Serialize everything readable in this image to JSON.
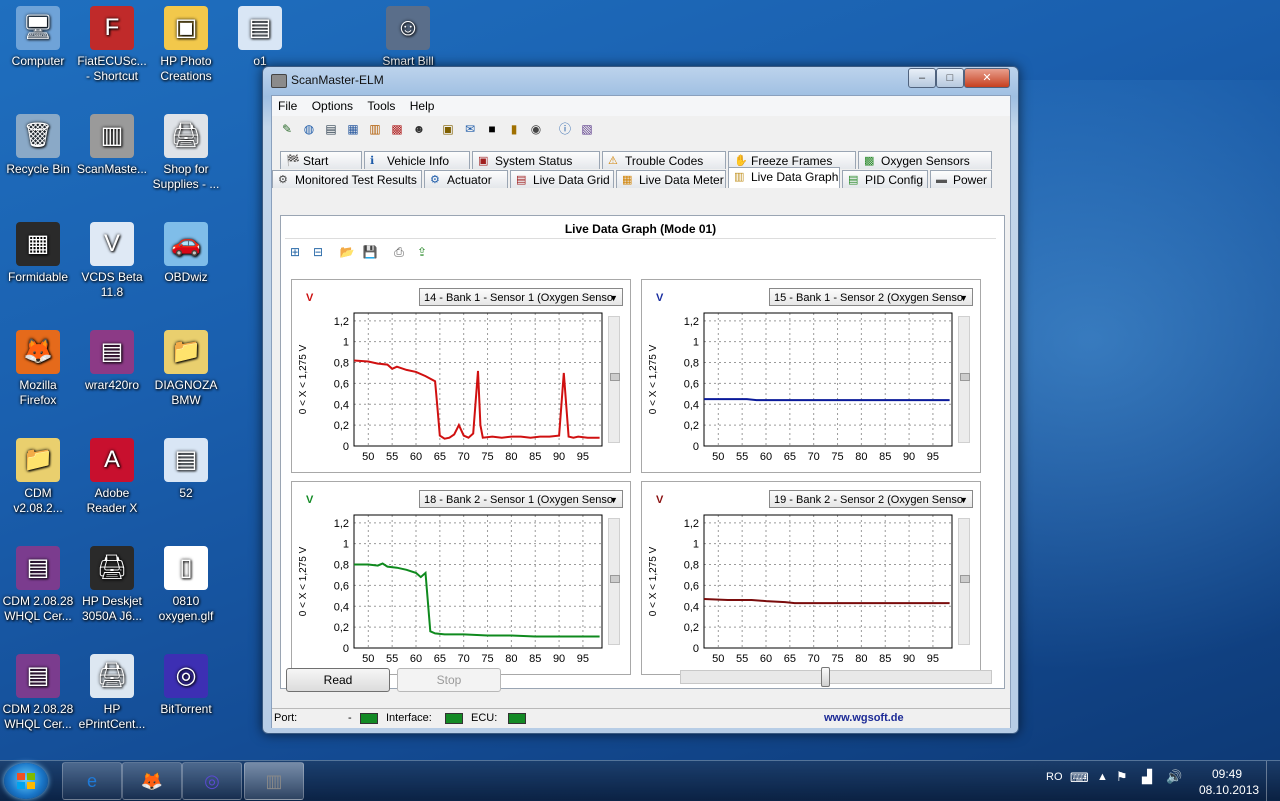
{
  "desktop": {
    "icons": [
      {
        "label": "Computer",
        "col": 0,
        "row": 0,
        "glyph": "🖥",
        "bg": "#6fa3d8"
      },
      {
        "label": "Recycle Bin",
        "col": 0,
        "row": 1,
        "glyph": "🗑",
        "bg": "#8aa9c7"
      },
      {
        "label": "Formidable",
        "col": 0,
        "row": 2,
        "glyph": "▦",
        "bg": "#2a2a2a",
        "sc": true
      },
      {
        "label": "Mozilla Firefox",
        "col": 0,
        "row": 3,
        "glyph": "🦊",
        "bg": "#e56a1b"
      },
      {
        "label": "CDM v2.08.2...",
        "col": 0,
        "row": 4,
        "glyph": "📁",
        "bg": "#e9cf6e"
      },
      {
        "label": "CDM 2.08.28 WHQL Cer...",
        "col": 0,
        "row": 5,
        "glyph": "▤",
        "bg": "#7b3c8e"
      },
      {
        "label": "CDM 2.08.28 WHQL Cer...",
        "col": 0,
        "row": 6,
        "glyph": "▤",
        "bg": "#7b3c8e"
      },
      {
        "label": "FiatECUSc... - Shortcut",
        "col": 1,
        "row": 0,
        "glyph": "F",
        "bg": "#c02a2a",
        "sc": true
      },
      {
        "label": "ScanMaste...",
        "col": 1,
        "row": 1,
        "glyph": "▥",
        "bg": "#9a9a9a"
      },
      {
        "label": "VCDS Beta 11.8",
        "col": 1,
        "row": 2,
        "glyph": "V",
        "bg": "#dfe9f5",
        "sc": true
      },
      {
        "label": "wrar420ro",
        "col": 1,
        "row": 3,
        "glyph": "▤",
        "bg": "#8c3a86"
      },
      {
        "label": "Adobe Reader X",
        "col": 1,
        "row": 4,
        "glyph": "A",
        "bg": "#c8102e"
      },
      {
        "label": "HP Deskjet 3050A J6...",
        "col": 1,
        "row": 5,
        "glyph": "🖨",
        "bg": "#2a2a2a",
        "sc": true
      },
      {
        "label": "HP ePrintCent...",
        "col": 1,
        "row": 6,
        "glyph": "🖨",
        "bg": "#dde7f1",
        "sc": true
      },
      {
        "label": "HP Photo Creations",
        "col": 2,
        "row": 0,
        "glyph": "▣",
        "bg": "#f2c84b",
        "sc": true
      },
      {
        "label": "Shop for Supplies - ...",
        "col": 2,
        "row": 1,
        "glyph": "🖨",
        "bg": "#dfe3e8",
        "sc": true
      },
      {
        "label": "OBDwiz",
        "col": 2,
        "row": 2,
        "glyph": "🚗",
        "bg": "#7fbde9",
        "sc": true
      },
      {
        "label": "DIAGNOZA BMW",
        "col": 2,
        "row": 3,
        "glyph": "📁",
        "bg": "#e9cf6e"
      },
      {
        "label": "52",
        "col": 2,
        "row": 4,
        "glyph": "▤",
        "bg": "#d9e6f5"
      },
      {
        "label": "0810 oxygen.glf",
        "col": 2,
        "row": 5,
        "glyph": "▯",
        "bg": "#ffffff"
      },
      {
        "label": "BitTorrent",
        "col": 2,
        "row": 6,
        "glyph": "◎",
        "bg": "#3d2fb3",
        "sc": true
      },
      {
        "label": "o1",
        "col": 3,
        "row": 0,
        "glyph": "▤",
        "bg": "#d9e6f5"
      },
      {
        "label": "Smart Bill",
        "col": 5,
        "row": 0,
        "glyph": "☺",
        "bg": "#5a6e8a",
        "sc": true
      }
    ]
  },
  "window": {
    "title": "ScanMaster-ELM",
    "controls": {
      "minimize": "–",
      "maximize": "□",
      "close": "✕"
    },
    "menu": [
      "File",
      "Options",
      "Tools",
      "Help"
    ],
    "toolbar_icons": [
      "wizard-icon",
      "globe-icon",
      "document-icon",
      "grid-icon",
      "chart-icon",
      "palette-icon",
      "person-icon",
      "clipboard-icon",
      "chat-icon",
      "terminal-icon",
      "battery-icon",
      "dial-icon",
      "info-icon",
      "book-icon"
    ],
    "tabs_row1": [
      {
        "label": "Start",
        "icon": "🏁"
      },
      {
        "label": "Vehicle Info",
        "icon": "ℹ"
      },
      {
        "label": "System Status",
        "icon": "▣"
      },
      {
        "label": "Trouble Codes",
        "icon": "⚠"
      },
      {
        "label": "Freeze Frames",
        "icon": "✋"
      },
      {
        "label": "Oxygen Sensors",
        "icon": "▩"
      }
    ],
    "tabs_row2": [
      {
        "label": "Monitored Test Results",
        "icon": "⚙"
      },
      {
        "label": "Actuator",
        "icon": "⚙"
      },
      {
        "label": "Live Data Grid",
        "icon": "▤"
      },
      {
        "label": "Live Data Meter",
        "icon": "▦"
      },
      {
        "label": "Live Data Graph",
        "icon": "▥",
        "active": true
      },
      {
        "label": "PID Config",
        "icon": "▤"
      },
      {
        "label": "Power",
        "icon": "▬"
      }
    ],
    "panel": {
      "title": "Live Data Graph (Mode 01)",
      "tool_icons": [
        "add-pid-icon",
        "remove-pid-icon",
        "open-icon",
        "save-icon",
        "print-icon",
        "export-icon"
      ]
    },
    "buttons": {
      "read": "Read",
      "stop": "Stop"
    },
    "slider_level": 0.45,
    "status": {
      "port_label": "Port:",
      "port_value": "-",
      "interface_label": "Interface:",
      "ecu_label": "ECU:",
      "url": "www.wgsoft.de"
    },
    "colors": {
      "led": "#138a25",
      "url": "#1c2a96"
    }
  },
  "chart_data": [
    {
      "type": "line",
      "unit": "V",
      "unit_color": "#cc1111",
      "selector": "14 - Bank 1 - Sensor 1 (Oxygen Senso",
      "ylabel": "0 < X < 1,275 V",
      "xlim": [
        47,
        99
      ],
      "ylim": [
        0,
        1.275
      ],
      "xticks": [
        50,
        55,
        60,
        65,
        70,
        75,
        80,
        85,
        90,
        95
      ],
      "yticks": [
        0,
        0.2,
        0.4,
        0.6,
        0.8,
        1,
        1.2
      ],
      "yticklabels": [
        "0",
        "0,2",
        "0,4",
        "0,6",
        "0,8",
        "1",
        "1,2"
      ],
      "grid": true,
      "series": [
        {
          "color": "#d01010",
          "x": [
            47,
            50,
            52,
            54,
            55,
            56,
            58,
            60,
            62,
            64,
            64.5,
            65,
            66,
            67,
            68,
            69,
            70,
            71,
            72,
            73,
            73.5,
            74,
            76,
            78,
            80,
            82,
            84,
            86,
            88,
            90,
            91,
            92,
            93,
            94,
            96,
            98.5
          ],
          "y": [
            0.82,
            0.81,
            0.79,
            0.78,
            0.74,
            0.76,
            0.73,
            0.71,
            0.67,
            0.62,
            0.36,
            0.1,
            0.07,
            0.08,
            0.11,
            0.2,
            0.1,
            0.08,
            0.12,
            0.72,
            0.2,
            0.08,
            0.09,
            0.08,
            0.09,
            0.09,
            0.08,
            0.09,
            0.09,
            0.1,
            0.7,
            0.09,
            0.08,
            0.09,
            0.08,
            0.08
          ]
        }
      ]
    },
    {
      "type": "line",
      "unit": "V",
      "unit_color": "#1a2ea0",
      "selector": "15 - Bank 1 - Sensor 2 (Oxygen Senso",
      "ylabel": "0 < X < 1,275 V",
      "xlim": [
        47,
        99
      ],
      "ylim": [
        0,
        1.275
      ],
      "xticks": [
        50,
        55,
        60,
        65,
        70,
        75,
        80,
        85,
        90,
        95
      ],
      "yticks": [
        0,
        0.2,
        0.4,
        0.6,
        0.8,
        1,
        1.2
      ],
      "yticklabels": [
        "0",
        "0,2",
        "0,4",
        "0,6",
        "0,8",
        "1",
        "1,2"
      ],
      "grid": true,
      "series": [
        {
          "color": "#0a1a9a",
          "x": [
            47,
            52,
            56,
            58,
            65,
            75,
            85,
            98.5
          ],
          "y": [
            0.45,
            0.45,
            0.45,
            0.44,
            0.44,
            0.44,
            0.44,
            0.44
          ]
        }
      ]
    },
    {
      "type": "line",
      "unit": "V",
      "unit_color": "#138a25",
      "selector": "18 - Bank 2 - Sensor 1 (Oxygen Senso",
      "ylabel": "0 < X < 1,275 V",
      "xlim": [
        47,
        99
      ],
      "ylim": [
        0,
        1.275
      ],
      "xticks": [
        50,
        55,
        60,
        65,
        70,
        75,
        80,
        85,
        90,
        95
      ],
      "yticks": [
        0,
        0.2,
        0.4,
        0.6,
        0.8,
        1,
        1.2
      ],
      "yticklabels": [
        "0",
        "0,2",
        "0,4",
        "0,6",
        "0,8",
        "1",
        "1,2"
      ],
      "grid": true,
      "series": [
        {
          "color": "#0f8a1e",
          "x": [
            47,
            50,
            52,
            53,
            54,
            56,
            58,
            60,
            61,
            62,
            63,
            64,
            66,
            70,
            75,
            80,
            85,
            90,
            98.5
          ],
          "y": [
            0.8,
            0.8,
            0.79,
            0.81,
            0.78,
            0.77,
            0.75,
            0.72,
            0.68,
            0.72,
            0.16,
            0.14,
            0.13,
            0.13,
            0.12,
            0.12,
            0.11,
            0.11,
            0.11
          ]
        }
      ]
    },
    {
      "type": "line",
      "unit": "V",
      "unit_color": "#8a1010",
      "selector": "19 - Bank 2 - Sensor 2 (Oxygen Senso",
      "ylabel": "0 < X < 1,275 V",
      "xlim": [
        47,
        99
      ],
      "ylim": [
        0,
        1.275
      ],
      "xticks": [
        50,
        55,
        60,
        65,
        70,
        75,
        80,
        85,
        90,
        95
      ],
      "yticks": [
        0,
        0.2,
        0.4,
        0.6,
        0.8,
        1,
        1.2
      ],
      "yticklabels": [
        "0",
        "0,2",
        "0,4",
        "0,6",
        "0,8",
        "1",
        "1,2"
      ],
      "grid": true,
      "series": [
        {
          "color": "#7a0c0c",
          "x": [
            47,
            52,
            57,
            60,
            64,
            66,
            75,
            85,
            95,
            98.5
          ],
          "y": [
            0.47,
            0.46,
            0.46,
            0.45,
            0.44,
            0.43,
            0.43,
            0.43,
            0.43,
            0.43
          ]
        }
      ]
    }
  ],
  "taskbar": {
    "items": [
      {
        "name": "ie-taskbar-item",
        "glyph": "e"
      },
      {
        "name": "firefox-taskbar-item",
        "glyph": "🦊"
      },
      {
        "name": "bittorrent-taskbar-item",
        "glyph": "◎"
      },
      {
        "name": "scanmaster-taskbar-item",
        "glyph": "▥"
      }
    ],
    "lang": "RO",
    "time": "09:49",
    "date": "08.10.2013"
  }
}
